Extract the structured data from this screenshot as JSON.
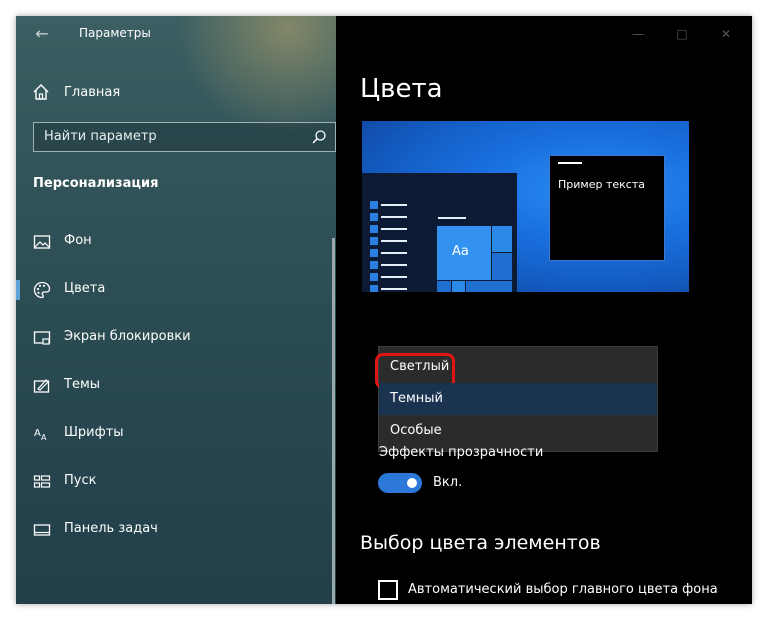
{
  "window": {
    "title": "Параметры",
    "back_icon": "back-arrow-icon",
    "controls": [
      "minimize-icon",
      "maximize-icon",
      "close-icon"
    ]
  },
  "sidebar": {
    "home_label": "Главная",
    "search_placeholder": "Найти параметр",
    "section_title": "Персонализация",
    "items": [
      {
        "label": "Фон",
        "icon": "picture-icon",
        "active": false
      },
      {
        "label": "Цвета",
        "icon": "palette-icon",
        "active": true
      },
      {
        "label": "Экран блокировки",
        "icon": "lock-screen-icon",
        "active": false
      },
      {
        "label": "Темы",
        "icon": "themes-icon",
        "active": false
      },
      {
        "label": "Шрифты",
        "icon": "fonts-icon",
        "active": false
      },
      {
        "label": "Пуск",
        "icon": "start-icon",
        "active": false
      },
      {
        "label": "Панель задач",
        "icon": "taskbar-icon",
        "active": false
      }
    ]
  },
  "main": {
    "title": "Цвета",
    "preview": {
      "tile_text": "Aa",
      "sample_text": "Пример текста"
    },
    "mode_dropdown": {
      "options": [
        "Светлый",
        "Темный",
        "Особые"
      ],
      "highlighted": "Светлый",
      "hovered": "Темный"
    },
    "transparency": {
      "label": "Эффекты прозрачности",
      "toggle_state": "Вкл."
    },
    "accent_heading": "Выбор цвета элементов",
    "auto_accent_checkbox": "Автоматический выбор главного цвета фона"
  },
  "colors": {
    "accent": "#2b78d8",
    "highlight_border": "#e01515",
    "content_bg": "#000000"
  }
}
